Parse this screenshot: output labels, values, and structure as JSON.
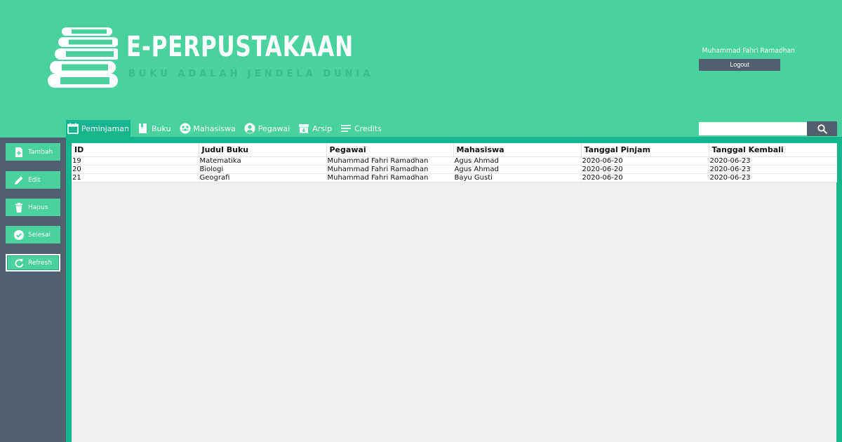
{
  "header": {
    "title": "E-PERPUSTAKAAN",
    "subtitle": "BUKU ADALAH JENDELA DUNIA",
    "user_name": "Muhammad Fahri Ramadhan",
    "logout_label": "Logout"
  },
  "nav": {
    "items": [
      {
        "label": "Peminjaman",
        "icon": "calendar-icon",
        "active": true
      },
      {
        "label": "Buku",
        "icon": "book-icon"
      },
      {
        "label": "Mahasiswa",
        "icon": "user-group-icon"
      },
      {
        "label": "Pegawai",
        "icon": "user-icon"
      },
      {
        "label": "Arsip",
        "icon": "archive-icon"
      },
      {
        "label": "Credits",
        "icon": "list-icon"
      }
    ]
  },
  "search": {
    "placeholder": "",
    "value": "",
    "icon": "search-icon"
  },
  "sidebar": {
    "buttons": [
      {
        "label": "Tambah",
        "icon": "file-add-icon"
      },
      {
        "label": "Edit",
        "icon": "pencil-icon"
      },
      {
        "label": "Hapus",
        "icon": "trash-icon"
      },
      {
        "label": "Selesai",
        "icon": "check-circle-icon"
      },
      {
        "label": "Refresh",
        "icon": "refresh-icon"
      }
    ]
  },
  "table": {
    "columns": [
      "ID",
      "Judul Buku",
      "Pegawai",
      "Mahasiswa",
      "Tanggal Pinjam",
      "Tanggal Kembali"
    ],
    "rows": [
      [
        "19",
        "Matematika",
        "Muhammad Fahri Ramadhan",
        "Agus Ahmad",
        "2020-06-20",
        "2020-06-23"
      ],
      [
        "20",
        "Biologi",
        "Muhammad Fahri Ramadhan",
        "Agus Ahmad",
        "2020-06-20",
        "2020-06-23"
      ],
      [
        "21",
        "Geografi",
        "Muhammad Fahri Ramadhan",
        "Bayu Gusti",
        "2020-06-20",
        "2020-06-23"
      ]
    ]
  },
  "colors": {
    "primary": "#49d1a0",
    "accent_dark": "#16b58e",
    "slate": "#525f6e",
    "content_bg": "#efefef"
  }
}
